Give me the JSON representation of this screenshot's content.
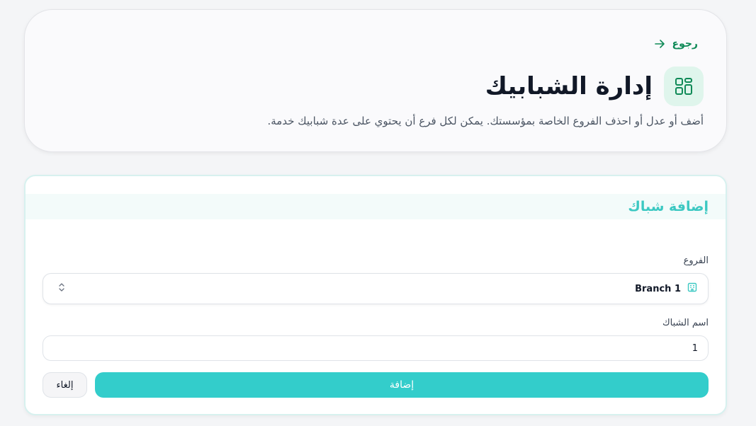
{
  "header": {
    "back_label": "رجوع",
    "title": "إدارة الشبابيك",
    "subtitle": "أضف أو عدل أو احذف الفروع الخاصة بمؤسستك. يمكن لكل فرع أن يحتوي على عدة شبابيك خدمة.",
    "icons": {
      "back": "arrow-right-icon",
      "title": "grid-icon"
    }
  },
  "form": {
    "title": "إضافة شباك",
    "branch_label": "الفروع",
    "branch_value": "Branch 1",
    "window_name_label": "اسم الشباك",
    "window_name_value": "1",
    "submit_label": "إضافة",
    "cancel_label": "إلغاء",
    "icons": {
      "branch": "building-icon",
      "select": "chevron-up-down-icon"
    }
  },
  "colors": {
    "accent_green": "#0f8a57",
    "title_icon_bg": "#dff5ec",
    "teal": "#33cdcb",
    "form_title": "#3cc8c2"
  }
}
